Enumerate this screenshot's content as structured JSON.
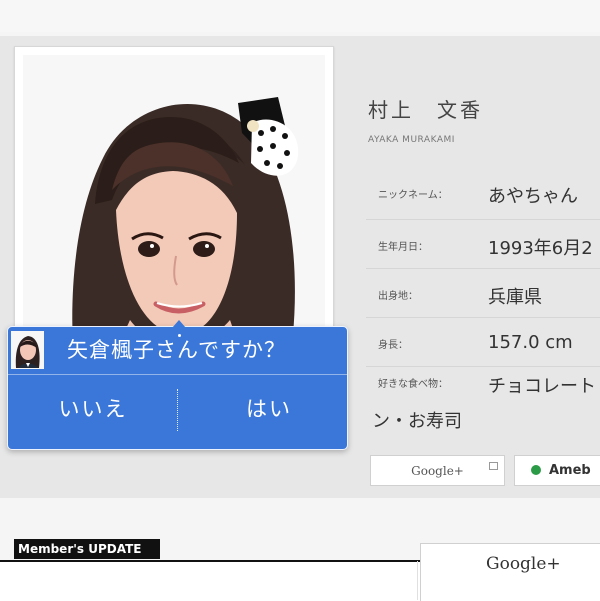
{
  "profile": {
    "name_ja": "村上　文香",
    "name_en": "AYAKA MURAKAMI",
    "details": [
      {
        "label": "ニックネーム：",
        "value": "あやちゃん"
      },
      {
        "label": "生年月日：",
        "value": "1993年6月2"
      },
      {
        "label": "出身地：",
        "value": "兵庫県"
      },
      {
        "label": "身長：",
        "value": "157.0 cm"
      },
      {
        "label": "好きな食べ物：",
        "value": "チョコレート",
        "continuation": "ン・お寿司"
      }
    ],
    "share_buttons": [
      {
        "label": "Google+"
      },
      {
        "label": "Ameb"
      }
    ]
  },
  "dialog": {
    "question": "矢倉楓子さんですか？",
    "no_label": "いいえ",
    "yes_label": "はい"
  },
  "member_update": {
    "badge": "Member's UPDATE",
    "google_label": "Google+"
  },
  "colors": {
    "dialog_blue": "#3a77d8",
    "panel_gray": "#e7e7e7"
  }
}
